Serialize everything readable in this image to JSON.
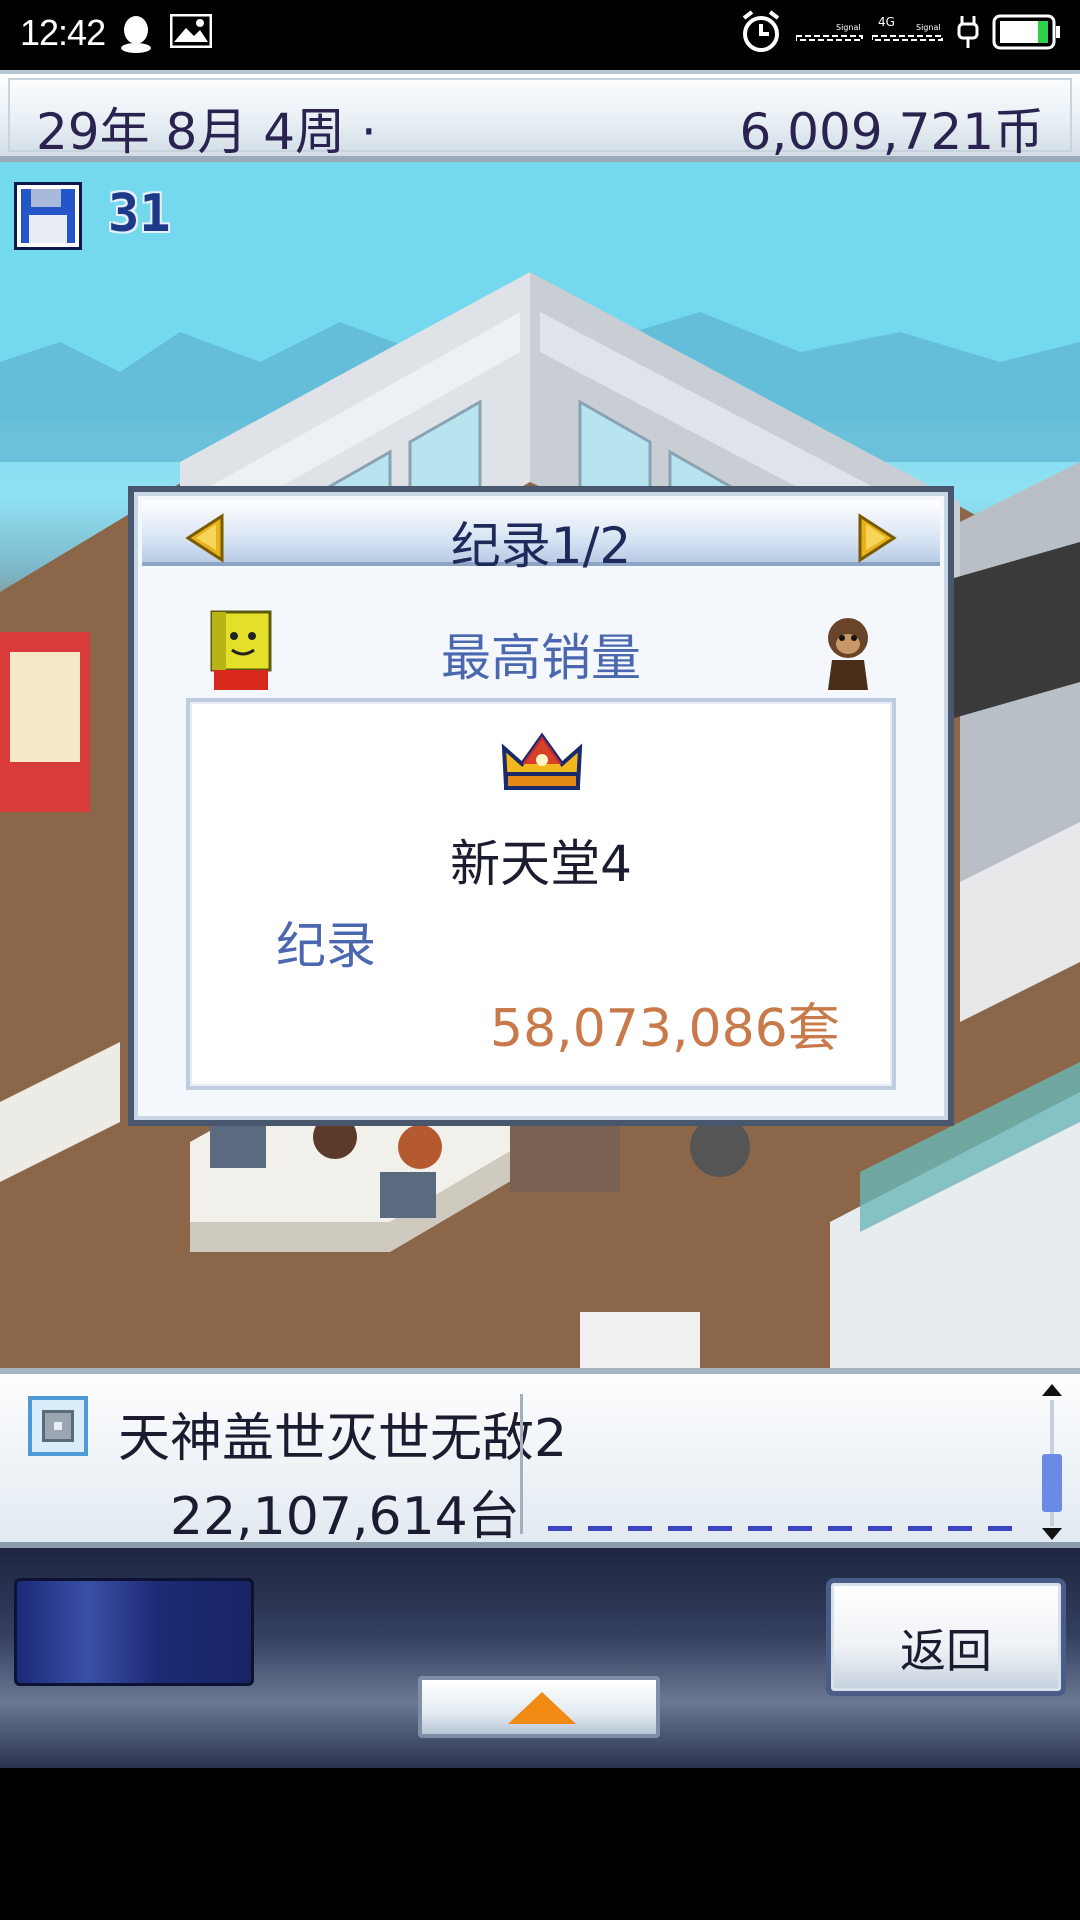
{
  "status_bar": {
    "time": "12:42",
    "icons": [
      "qq-icon",
      "image-icon",
      "alarm-icon",
      "signal-icon",
      "4g-signal-icon",
      "charging-icon",
      "battery-icon"
    ],
    "signal_labels": [
      "Signal",
      "4G",
      "Signal"
    ]
  },
  "top_bar": {
    "date": "29年 8月 4周 ·",
    "money": "6,009,721币"
  },
  "scene": {
    "save_count": "31"
  },
  "record_dialog": {
    "title": "纪录1/2",
    "category": "最高销量",
    "game_name": "新天堂4",
    "record_label": "纪录",
    "record_value": "58,073,086套"
  },
  "info_panel": {
    "console_name": "天神盖世灭世无敌2",
    "units_sold": "22,107,614台"
  },
  "controls": {
    "back_label": "返回"
  },
  "colors": {
    "dialog_text": "#1e2a5a",
    "accent_blue": "#4a67b0",
    "record_orange": "#c97a4a",
    "arrow_orange": "#f08a12"
  }
}
